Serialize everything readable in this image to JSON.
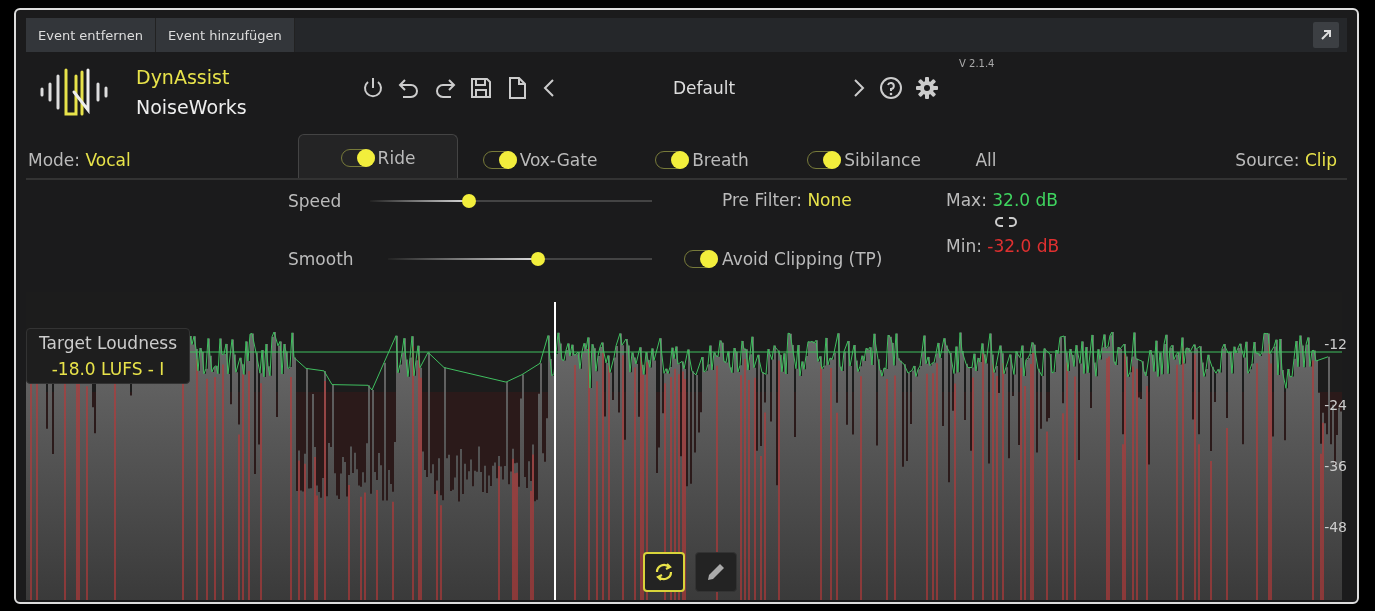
{
  "toolbar": {
    "buttons": [
      {
        "label": "Event entfernen"
      },
      {
        "label": "Event hinzufügen"
      }
    ]
  },
  "brand": {
    "product": "DynAssist",
    "company": "NoiseWorks"
  },
  "preset": {
    "name": "Default"
  },
  "version": "V 2.1.4",
  "mode": {
    "label": "Mode:",
    "value": "Vocal"
  },
  "tabs": [
    {
      "kind": "toggle",
      "label": "Ride",
      "on": true,
      "selected": true
    },
    {
      "kind": "toggle",
      "label": "Vox-Gate",
      "on": true,
      "selected": false
    },
    {
      "kind": "toggle",
      "label": "Breath",
      "on": true,
      "selected": false
    },
    {
      "kind": "toggle",
      "label": "Sibilance",
      "on": true,
      "selected": false
    },
    {
      "kind": "plain",
      "label": "All",
      "selected": false
    }
  ],
  "source": {
    "label": "Source:",
    "value": "Clip"
  },
  "sliders": [
    {
      "label": "Speed",
      "level": 0.35
    },
    {
      "label": "Smooth",
      "level": 0.57
    }
  ],
  "pre_filter": {
    "label": "Pre Filter:",
    "value": "None"
  },
  "avoid_clipping": {
    "label": "Avoid Clipping (TP)",
    "on": true
  },
  "max": {
    "label": "Max:",
    "value": "32.0 dB"
  },
  "min": {
    "label": "Min:",
    "value": "-32.0 dB"
  },
  "target": {
    "title": "Target Loudness",
    "value": "-18.0 LUFS - I"
  },
  "db_scale": [
    "-12",
    "-24",
    "-36",
    "-48"
  ],
  "tools": [
    {
      "kind": "loop",
      "selected": true
    },
    {
      "kind": "pencil",
      "selected": false
    }
  ]
}
